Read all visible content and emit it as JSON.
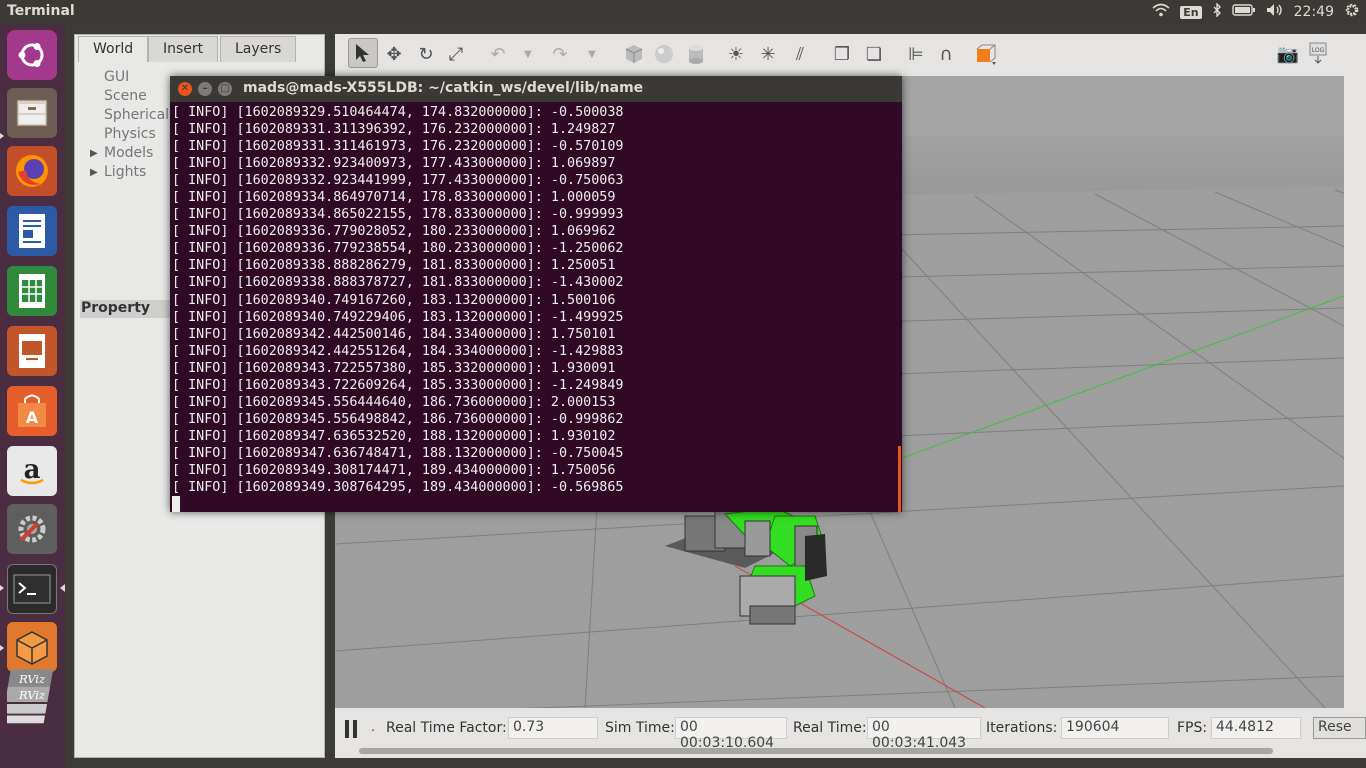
{
  "topbar": {
    "app_title": "Terminal",
    "lang": "En",
    "clock": "22:49"
  },
  "launcher": {
    "items": [
      "ubuntu-dash",
      "files",
      "firefox",
      "writer",
      "calc",
      "impress",
      "software-center",
      "amazon",
      "system-settings",
      "terminal",
      "gazebo",
      "rviz"
    ]
  },
  "gazebo": {
    "tabs": [
      "World",
      "Insert",
      "Layers"
    ],
    "tree": [
      "GUI",
      "Scene",
      "Spherical",
      "Physics",
      "Models",
      "Lights"
    ],
    "property_header": "Property",
    "bottom": {
      "rtf_label": "Real Time Factor:",
      "rtf_value": "0.73",
      "sim_label": "Sim Time:",
      "sim_value": "00 00:03:10.604",
      "real_label": "Real Time:",
      "real_value": "00 00:03:41.043",
      "iter_label": "Iterations:",
      "iter_value": "190604",
      "fps_label": "FPS:",
      "fps_value": "44.4812",
      "reset_label": "Rese"
    }
  },
  "terminal": {
    "title": "mads@mads-X555LDB: ~/catkin_ws/devel/lib/name",
    "lines": [
      "[ INFO] [1602089329.510464474, 174.832000000]: -0.500038",
      "[ INFO] [1602089331.311396392, 176.232000000]: 1.249827",
      "[ INFO] [1602089331.311461973, 176.232000000]: -0.570109",
      "[ INFO] [1602089332.923400973, 177.433000000]: 1.069897",
      "[ INFO] [1602089332.923441999, 177.433000000]: -0.750063",
      "[ INFO] [1602089334.864970714, 178.833000000]: 1.000059",
      "[ INFO] [1602089334.865022155, 178.833000000]: -0.999993",
      "[ INFO] [1602089336.779028052, 180.233000000]: 1.069962",
      "[ INFO] [1602089336.779238554, 180.233000000]: -1.250062",
      "[ INFO] [1602089338.888286279, 181.833000000]: 1.250051",
      "[ INFO] [1602089338.888378727, 181.833000000]: -1.430002",
      "[ INFO] [1602089340.749167260, 183.132000000]: 1.500106",
      "[ INFO] [1602089340.749229406, 183.132000000]: -1.499925",
      "[ INFO] [1602089342.442500146, 184.334000000]: 1.750101",
      "[ INFO] [1602089342.442551264, 184.334000000]: -1.429883",
      "[ INFO] [1602089343.722557380, 185.332000000]: 1.930091",
      "[ INFO] [1602089343.722609264, 185.333000000]: -1.249849",
      "[ INFO] [1602089345.556444640, 186.736000000]: 2.000153",
      "[ INFO] [1602089345.556498842, 186.736000000]: -0.999862",
      "[ INFO] [1602089347.636532520, 188.132000000]: 1.930102",
      "[ INFO] [1602089347.636748471, 188.132000000]: -0.750045",
      "[ INFO] [1602089349.308174471, 189.434000000]: 1.750056",
      "[ INFO] [1602089349.308764295, 189.434000000]: -0.569865"
    ]
  },
  "colors": {
    "terminal_bg": "#300a24",
    "launcher_bg": "#4b2d42",
    "scroll_accent": "#e9541f",
    "robot_green": "#33dd22"
  }
}
